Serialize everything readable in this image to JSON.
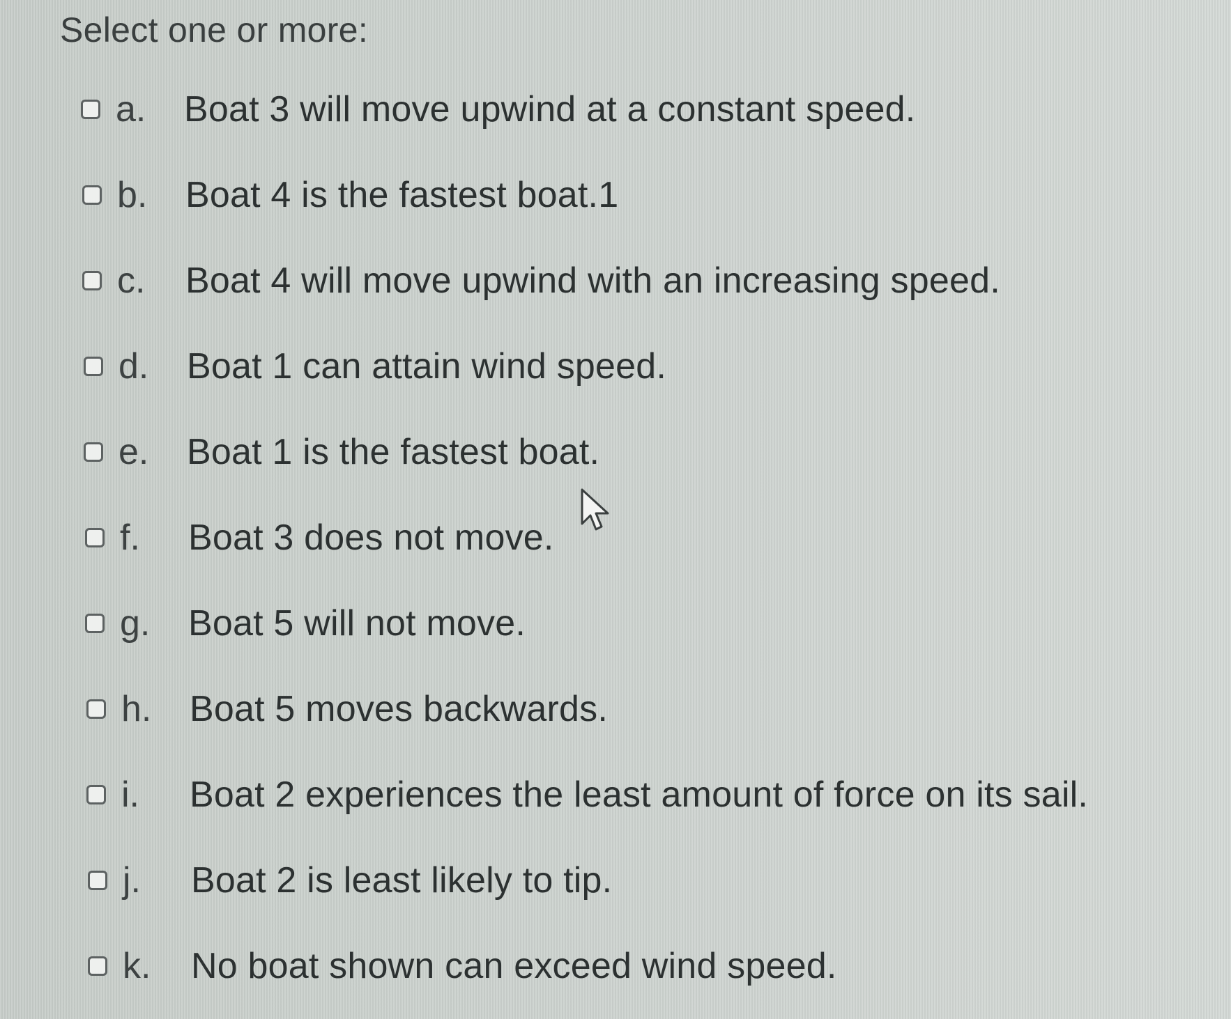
{
  "prompt": "Select one or more:",
  "options": [
    {
      "letter": "a.",
      "text": "Boat 3 will move upwind at a constant speed."
    },
    {
      "letter": "b.",
      "text": "Boat 4 is the fastest boat.1"
    },
    {
      "letter": "c.",
      "text": "Boat 4 will move upwind with an increasing speed."
    },
    {
      "letter": "d.",
      "text": "Boat 1 can attain wind speed."
    },
    {
      "letter": "e.",
      "text": "Boat 1 is the fastest boat."
    },
    {
      "letter": "f.",
      "text": "Boat 3 does not move."
    },
    {
      "letter": "g.",
      "text": "Boat 5 will not move."
    },
    {
      "letter": "h.",
      "text": "Boat 5 moves backwards."
    },
    {
      "letter": "i.",
      "text": "Boat 2 experiences the least amount of force on its sail."
    },
    {
      "letter": "j.",
      "text": "Boat 2 is least likely to tip."
    },
    {
      "letter": "k.",
      "text": "No boat shown can exceed wind speed."
    }
  ],
  "icons": {
    "checkbox": "checkbox-icon",
    "cursor": "mouse-pointer-icon"
  }
}
